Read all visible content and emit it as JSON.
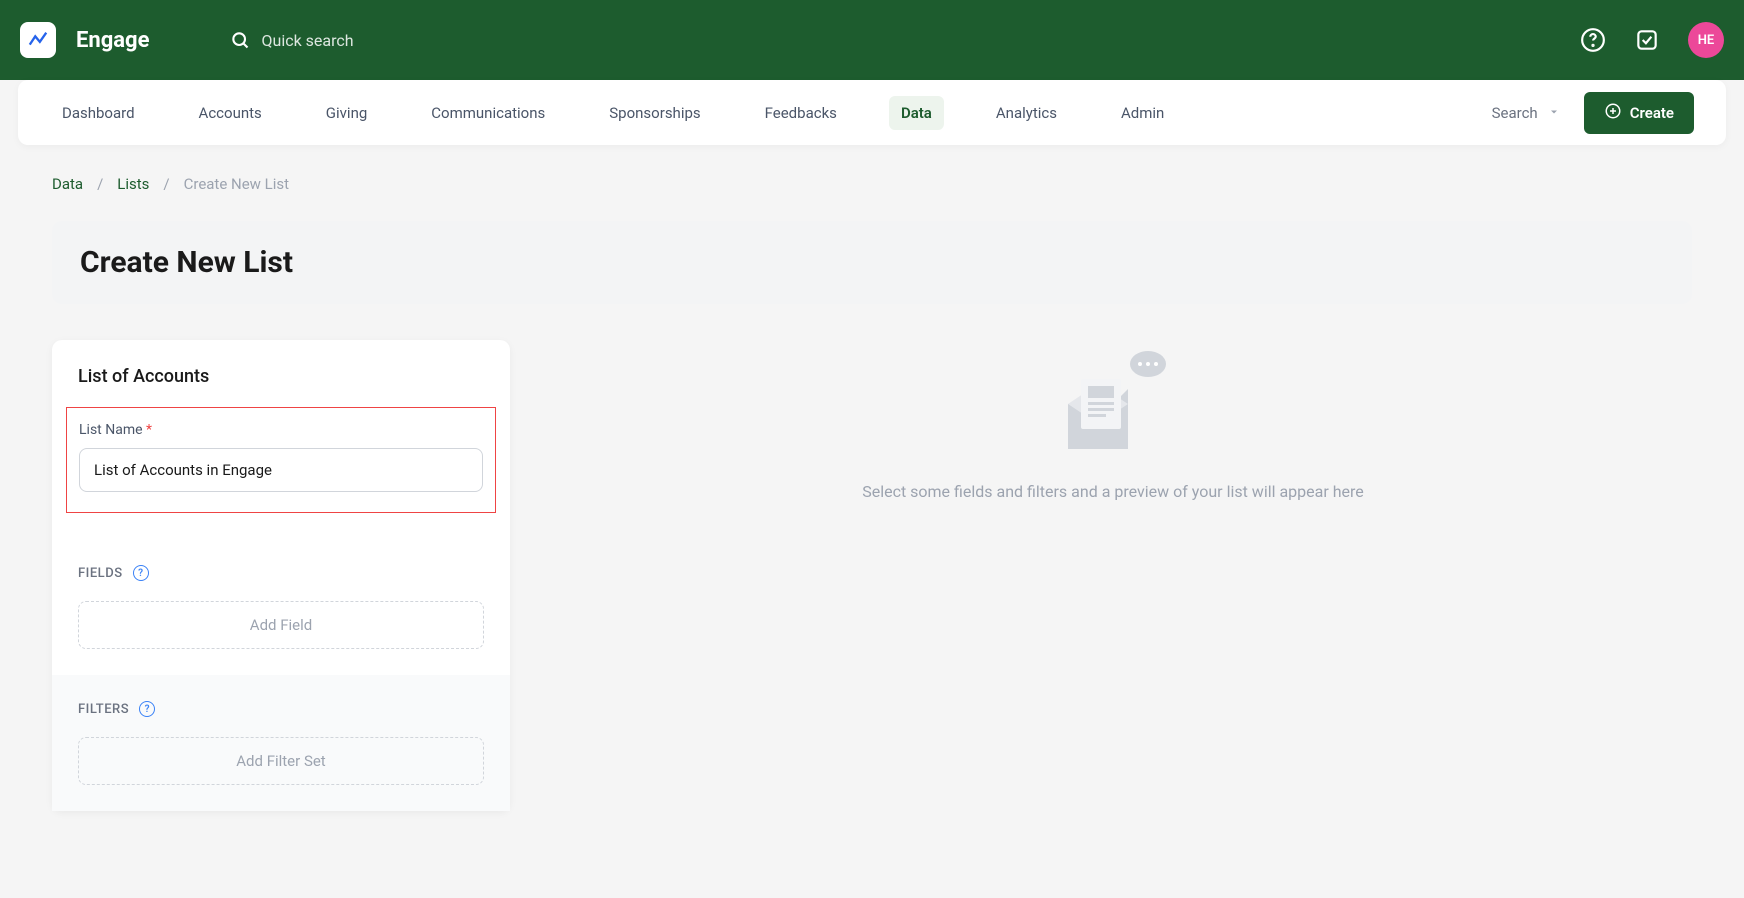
{
  "brand": "Engage",
  "quickSearch": {
    "placeholder": "Quick search"
  },
  "avatar": "HE",
  "nav": {
    "items": [
      "Dashboard",
      "Accounts",
      "Giving",
      "Communications",
      "Sponsorships",
      "Feedbacks",
      "Data",
      "Analytics",
      "Admin"
    ],
    "activeIndex": 6,
    "searchLabel": "Search",
    "createLabel": "Create"
  },
  "breadcrumb": {
    "items": [
      "Data",
      "Lists",
      "Create New List"
    ]
  },
  "page": {
    "title": "Create New List"
  },
  "form": {
    "sectionTitle": "List of Accounts",
    "listNameLabel": "List Name",
    "listNameValue": "List of Accounts in Engage",
    "fieldsLabel": "FIELDS",
    "addFieldLabel": "Add Field",
    "filtersLabel": "FILTERS",
    "addFilterSetLabel": "Add Filter Set"
  },
  "preview": {
    "emptyMessage": "Select some fields and filters and a preview of your list will appear here"
  }
}
